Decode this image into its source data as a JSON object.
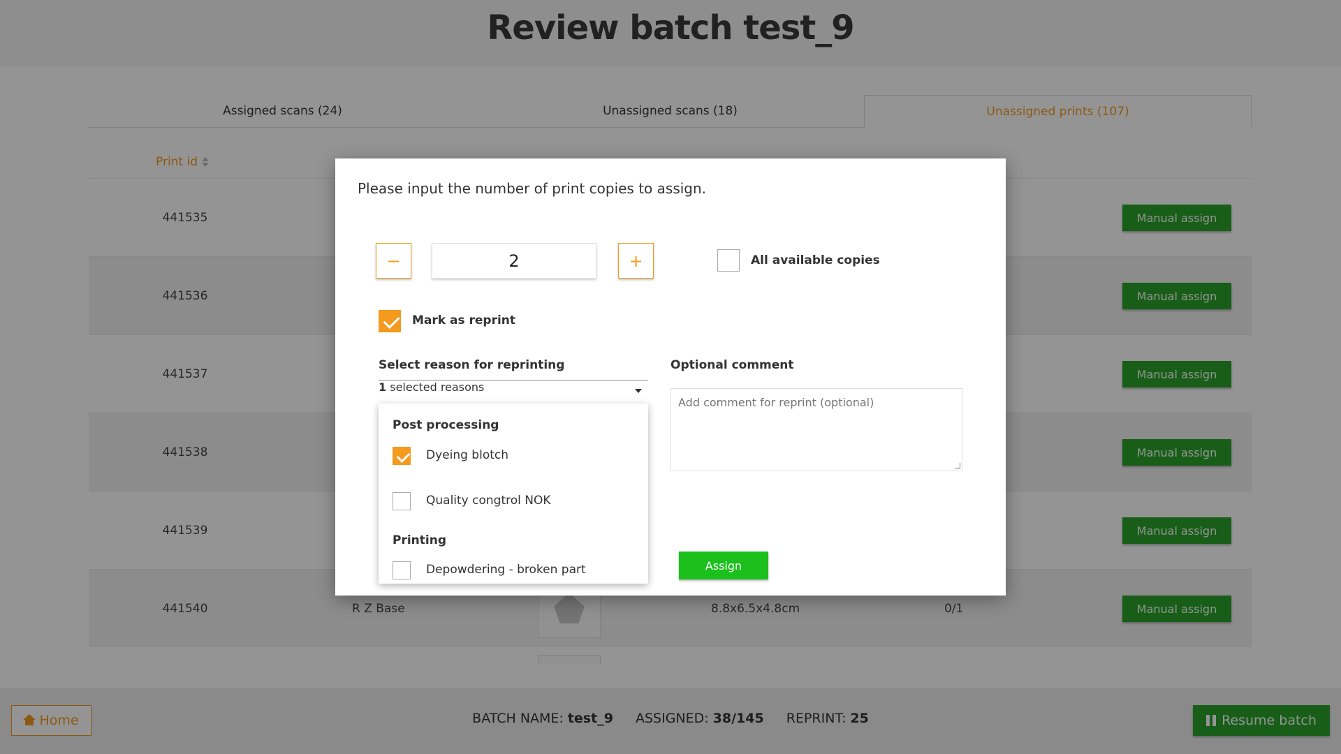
{
  "page": {
    "title": "Review batch test_9"
  },
  "tabs": [
    {
      "label": "Assigned scans (24)"
    },
    {
      "label": "Unassigned scans (18)"
    },
    {
      "label": "Unassigned prints (107)"
    }
  ],
  "table": {
    "column_print_id": "Print id",
    "manual_assign_label": "Manual assign",
    "rows": [
      {
        "id": "441535"
      },
      {
        "id": "441536"
      },
      {
        "id": "441537"
      },
      {
        "id": "441538"
      },
      {
        "id": "441539"
      },
      {
        "id": "441540",
        "name": "R Z Base",
        "dims": "8.8x6.5x4.8cm",
        "count": "0/1"
      }
    ]
  },
  "footer": {
    "home_label": "Home",
    "batch_name_label": "BATCH NAME:",
    "batch_name": "test_9",
    "assigned_label": "ASSIGNED:",
    "assigned": "38/145",
    "reprint_label": "REPRINT:",
    "reprint": "25",
    "resume_label": "Resume batch"
  },
  "modal": {
    "title": "Please input the number of print copies to assign.",
    "minus": "−",
    "plus": "+",
    "quantity": "2",
    "all_copies_label": "All available copies",
    "mark_reprint_label": "Mark as reprint",
    "reason_label": "Select reason for reprinting",
    "reason_count": "1",
    "reason_suffix": "selected reasons",
    "comment_label": "Optional comment",
    "comment_placeholder": "Add comment for reprint (optional)",
    "assign_label": "Assign",
    "dropdown": {
      "group1": "Post processing",
      "item1": "Dyeing blotch",
      "item2": "Quality congtrol NOK",
      "group2": "Printing",
      "item3": "Depowdering - broken part"
    }
  },
  "colors": {
    "accent": "#f39a1f",
    "green": "#2aa22a",
    "assign_green": "#1cc01c"
  }
}
